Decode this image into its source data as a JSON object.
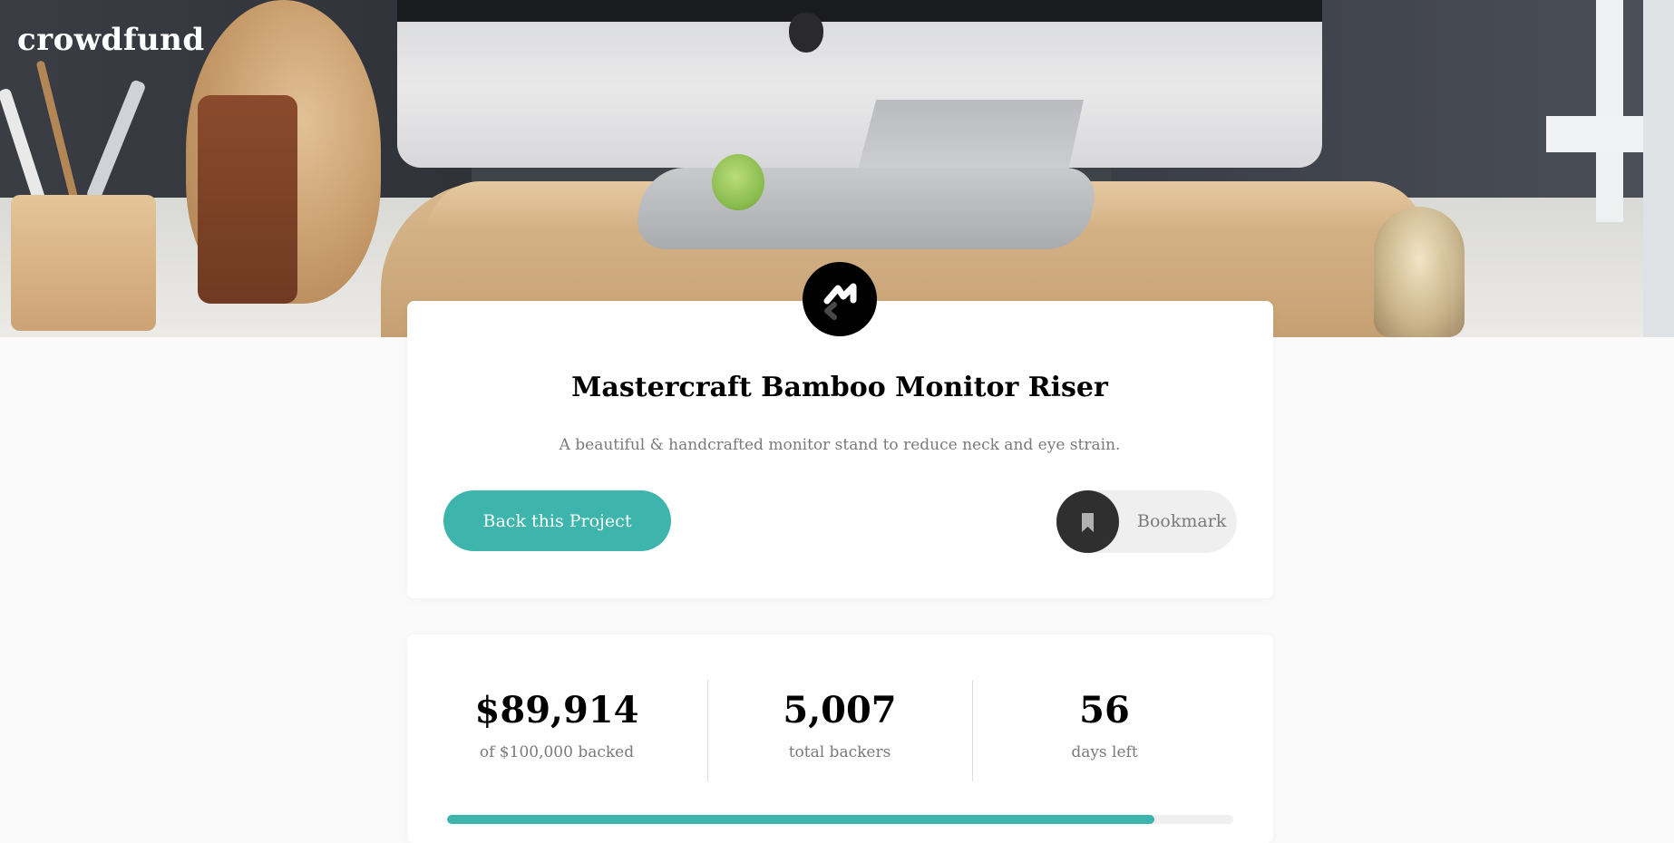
{
  "brand": {
    "name": "crowdfund"
  },
  "project": {
    "title": "Mastercraft Bamboo Monitor Riser",
    "description": "A beautiful & handcrafted monitor stand to reduce neck and eye strain.",
    "logo_icon": "mastercraft-logo-icon"
  },
  "actions": {
    "back_label": "Back this Project",
    "bookmark_label": "Bookmark",
    "bookmark_icon": "bookmark-icon"
  },
  "stats": {
    "backed_amount": "$89,914",
    "backed_label": "of $100,000 backed",
    "backers_count": "5,007",
    "backers_label": "total backers",
    "days_left": "56",
    "days_label": "days left",
    "progress_fraction": 0.8991
  },
  "colors": {
    "accent": "#3db4ac",
    "dark": "#2f2f2f",
    "muted_text": "#7a7a7a",
    "page_bg": "#fafafa"
  }
}
